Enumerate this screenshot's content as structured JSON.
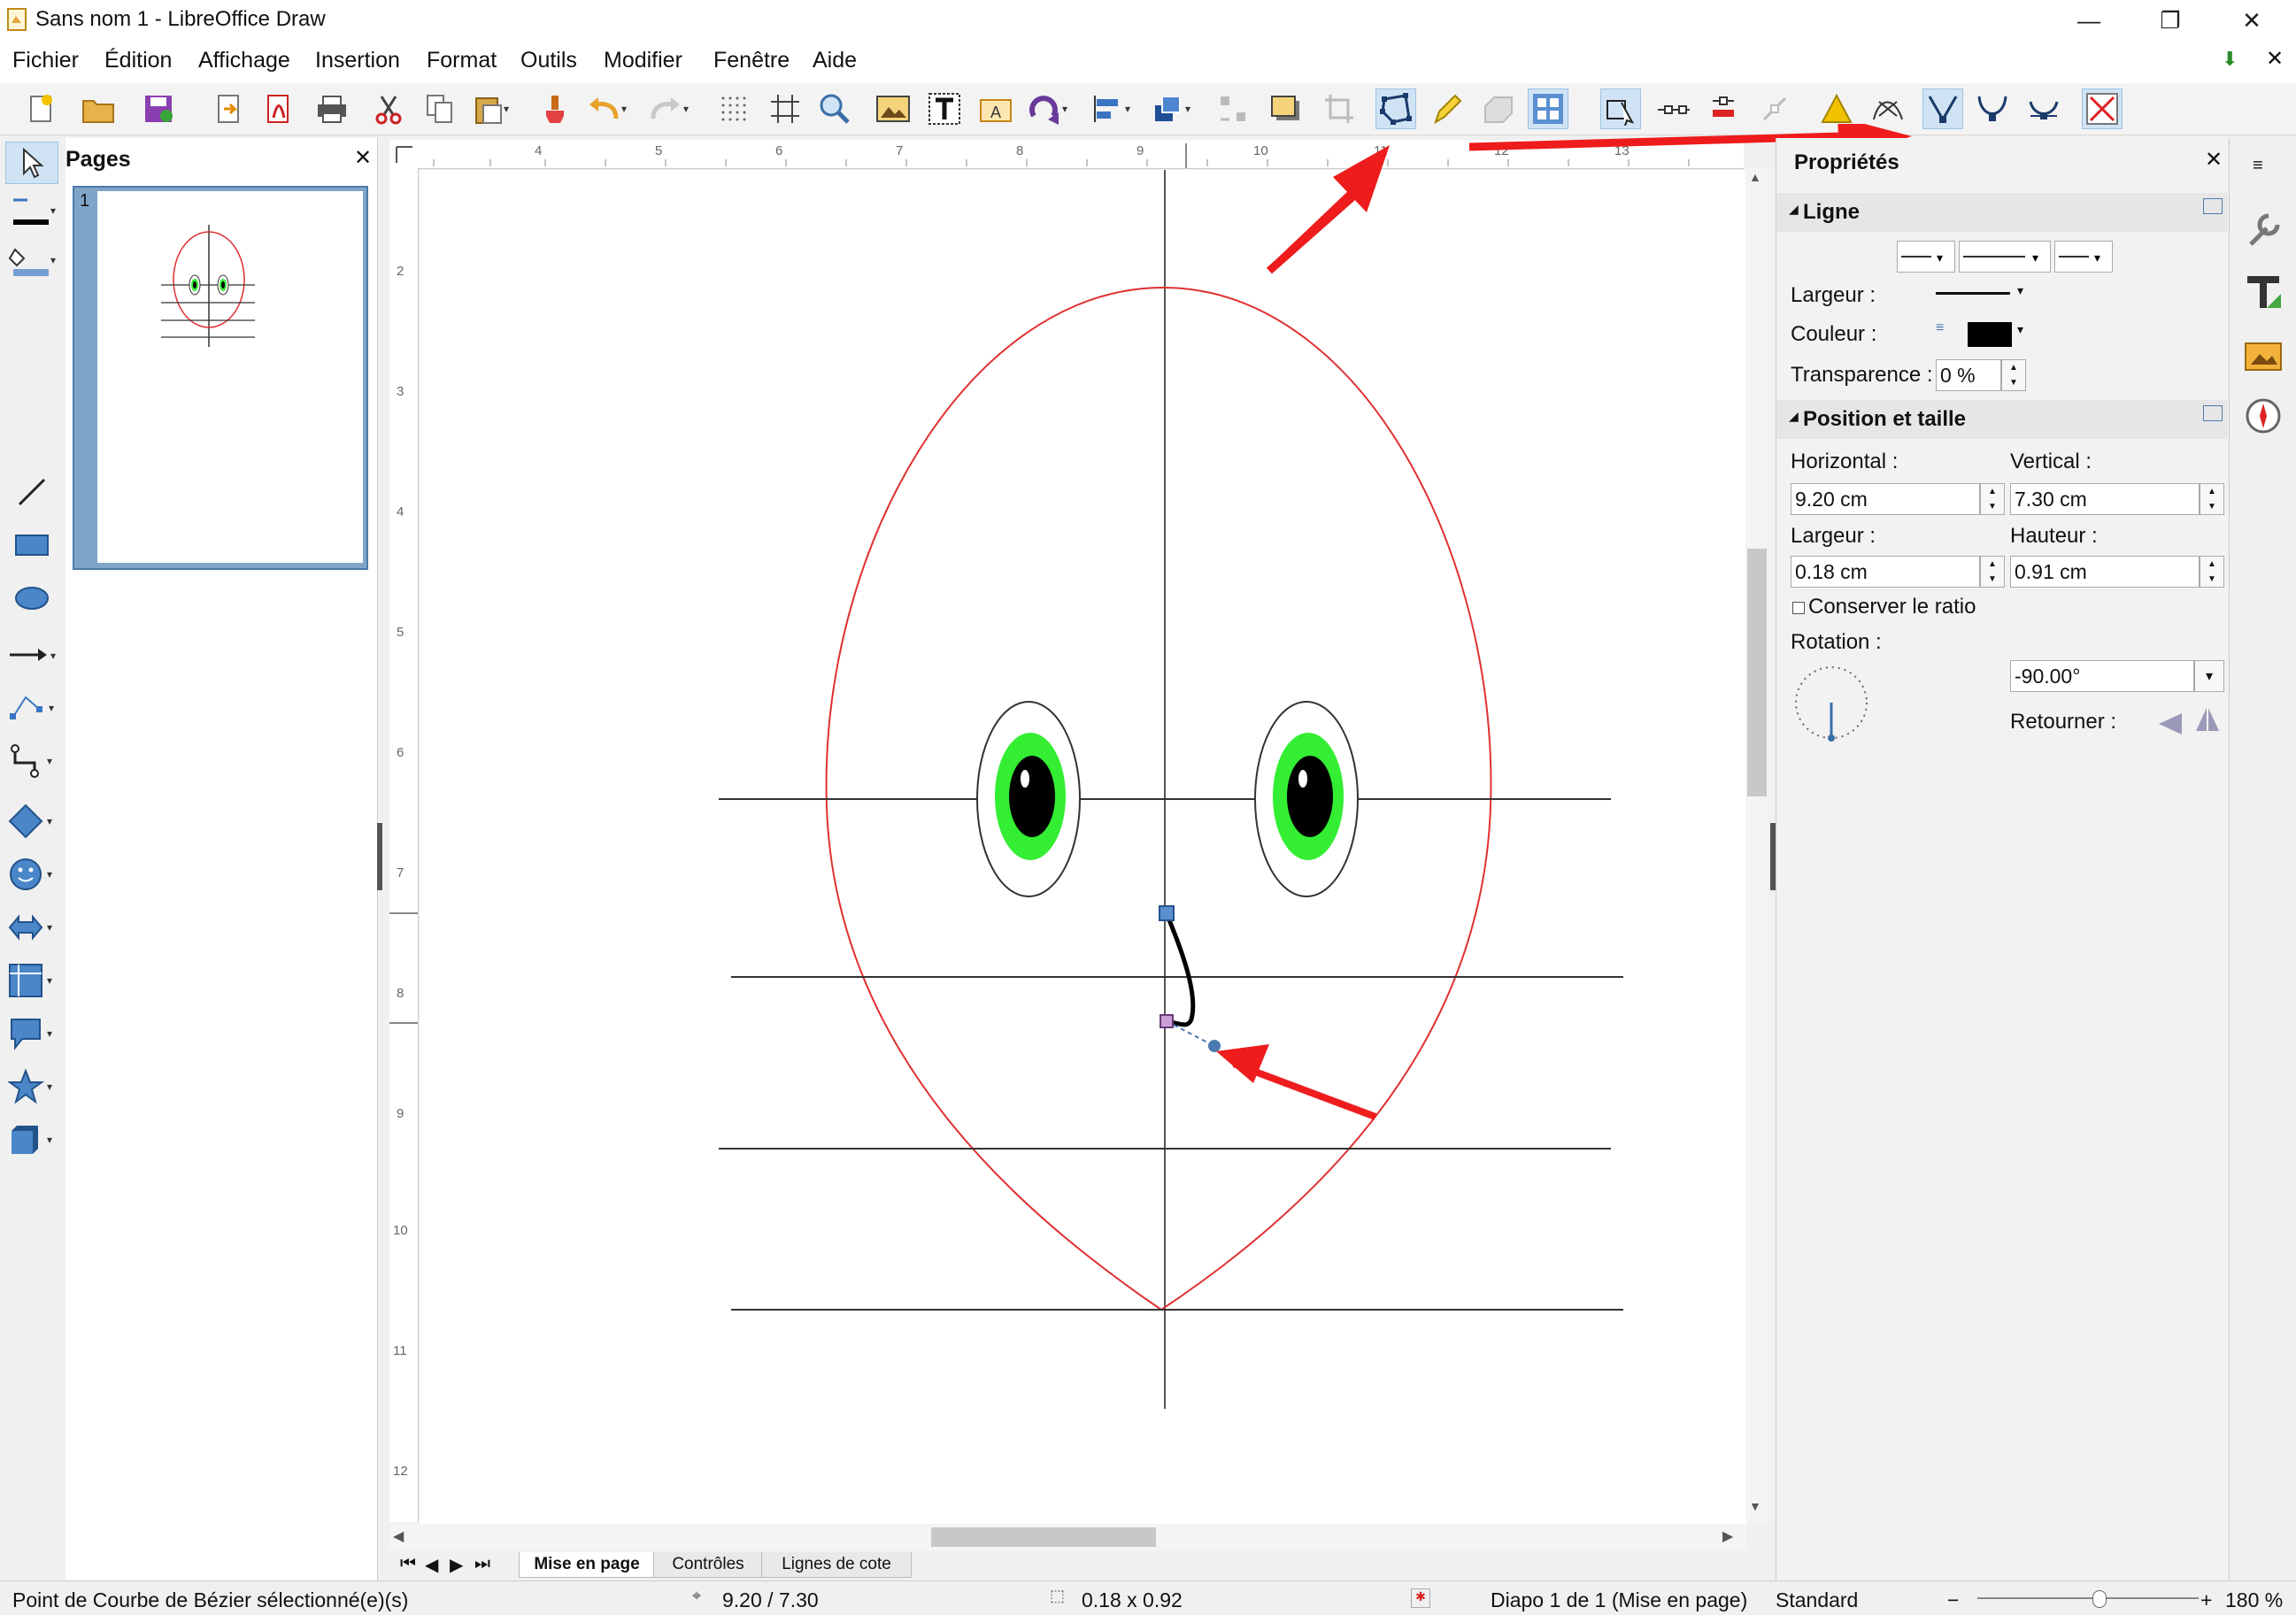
{
  "window": {
    "title": "Sans nom 1 - LibreOffice Draw",
    "minimize_icon": "minimize-icon",
    "restore_icon": "restore-icon",
    "close_icon": "close-icon"
  },
  "menu": {
    "items": [
      "Fichier",
      "Édition",
      "Affichage",
      "Insertion",
      "Format",
      "Outils",
      "Modifier",
      "Fenêtre",
      "Aide"
    ]
  },
  "pages_panel": {
    "title": "Pages",
    "close": "✕",
    "page_number": "1"
  },
  "ruler": {
    "top_ticks": [
      "4",
      "5",
      "6",
      "7",
      "8",
      "9",
      "10",
      "11",
      "12",
      "13"
    ],
    "left_ticks": [
      "2",
      "3",
      "4",
      "5",
      "6",
      "7",
      "8",
      "9",
      "10",
      "11",
      "12"
    ]
  },
  "tabs": {
    "items": [
      "Mise en page",
      "Contrôles",
      "Lignes de cote"
    ],
    "selected": "Mise en page"
  },
  "sidebar": {
    "title": "Propriétés",
    "close": "✕",
    "ligne": {
      "section_title": "Ligne",
      "largeur_label": "Largeur :",
      "couleur_label": "Couleur :",
      "couleur_value": "#000000",
      "transparence_label": "Transparence :",
      "transparence_value": "0 %"
    },
    "position": {
      "section_title": "Position et taille",
      "horizontal_label": "Horizontal :",
      "horizontal_value": "9.20 cm",
      "vertical_label": "Vertical :",
      "vertical_value": "7.30 cm",
      "largeur_label": "Largeur :",
      "largeur_value": "0.18 cm",
      "hauteur_label": "Hauteur :",
      "hauteur_value": "0.91 cm",
      "ratio_label": "Conserver le ratio",
      "rotation_label": "Rotation :",
      "rotation_value": "-90.00°",
      "retourner_label": "Retourner :"
    }
  },
  "status": {
    "message": "Point de Courbe de Bézier sélectionné(e)(s)",
    "position": "9.20 / 7.30",
    "size": "0.18 x 0.92",
    "slide": "Diapo 1 de 1 (Mise en page)",
    "style": "Standard",
    "zoom": "180 %"
  },
  "colors": {
    "face_outline": "#e03030",
    "iris": "#33ee33",
    "arrow": "#ee1c1c",
    "active_tool": "#cfe3f5",
    "handle": "#4a7ab0"
  }
}
